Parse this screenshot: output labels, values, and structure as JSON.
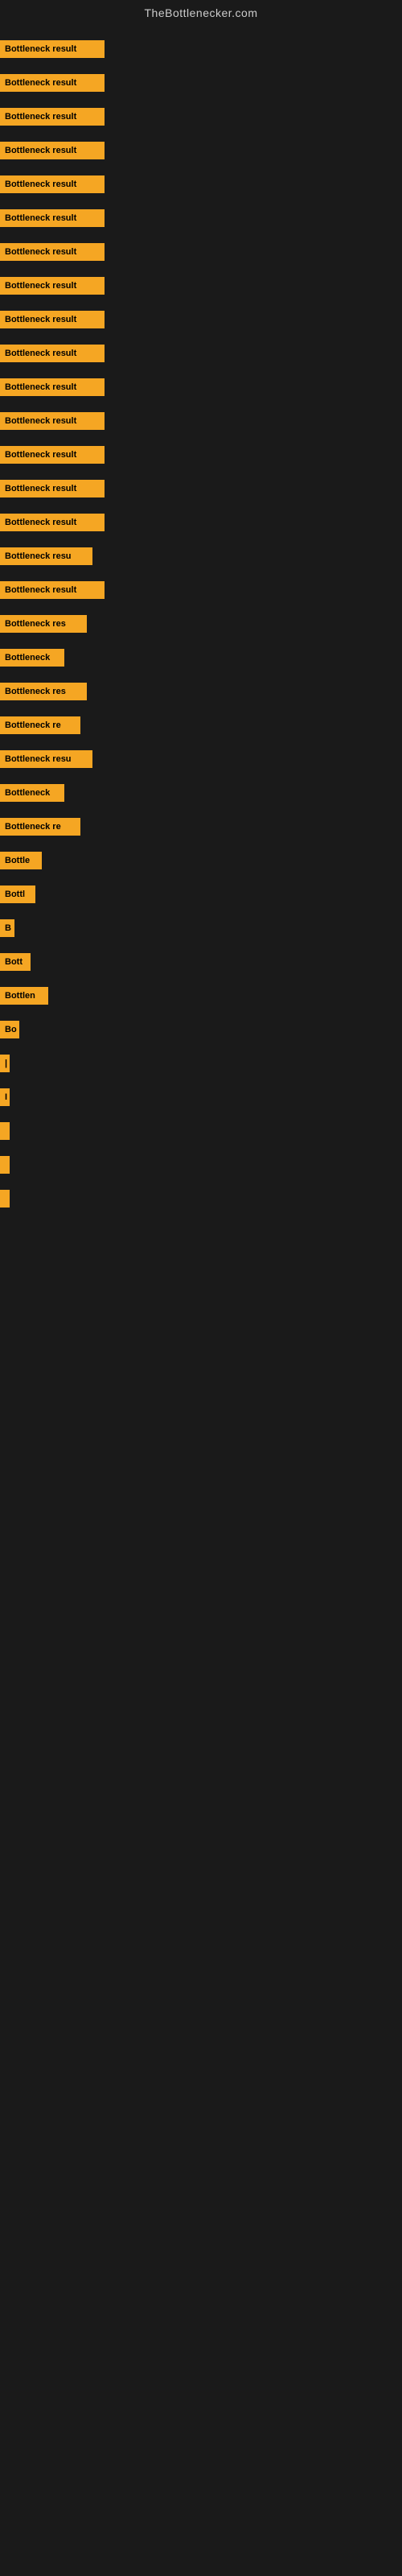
{
  "header": {
    "title": "TheBottlenecker.com"
  },
  "bars": [
    {
      "label": "Bottleneck result",
      "width": 130
    },
    {
      "label": "Bottleneck result",
      "width": 130
    },
    {
      "label": "Bottleneck result",
      "width": 130
    },
    {
      "label": "Bottleneck result",
      "width": 130
    },
    {
      "label": "Bottleneck result",
      "width": 130
    },
    {
      "label": "Bottleneck result",
      "width": 130
    },
    {
      "label": "Bottleneck result",
      "width": 130
    },
    {
      "label": "Bottleneck result",
      "width": 130
    },
    {
      "label": "Bottleneck result",
      "width": 130
    },
    {
      "label": "Bottleneck result",
      "width": 130
    },
    {
      "label": "Bottleneck result",
      "width": 130
    },
    {
      "label": "Bottleneck result",
      "width": 130
    },
    {
      "label": "Bottleneck result",
      "width": 130
    },
    {
      "label": "Bottleneck result",
      "width": 130
    },
    {
      "label": "Bottleneck result",
      "width": 130
    },
    {
      "label": "Bottleneck resu",
      "width": 115
    },
    {
      "label": "Bottleneck result",
      "width": 130
    },
    {
      "label": "Bottleneck res",
      "width": 108
    },
    {
      "label": "Bottleneck",
      "width": 80
    },
    {
      "label": "Bottleneck res",
      "width": 108
    },
    {
      "label": "Bottleneck re",
      "width": 100
    },
    {
      "label": "Bottleneck resu",
      "width": 115
    },
    {
      "label": "Bottleneck",
      "width": 80
    },
    {
      "label": "Bottleneck re",
      "width": 100
    },
    {
      "label": "Bottle",
      "width": 52
    },
    {
      "label": "Bottl",
      "width": 44
    },
    {
      "label": "B",
      "width": 18
    },
    {
      "label": "Bott",
      "width": 38
    },
    {
      "label": "Bottlen",
      "width": 60
    },
    {
      "label": "Bo",
      "width": 24
    },
    {
      "label": "|",
      "width": 8
    },
    {
      "label": "I",
      "width": 6
    },
    {
      "label": "",
      "width": 4
    },
    {
      "label": "",
      "width": 4
    },
    {
      "label": "",
      "width": 3
    }
  ]
}
